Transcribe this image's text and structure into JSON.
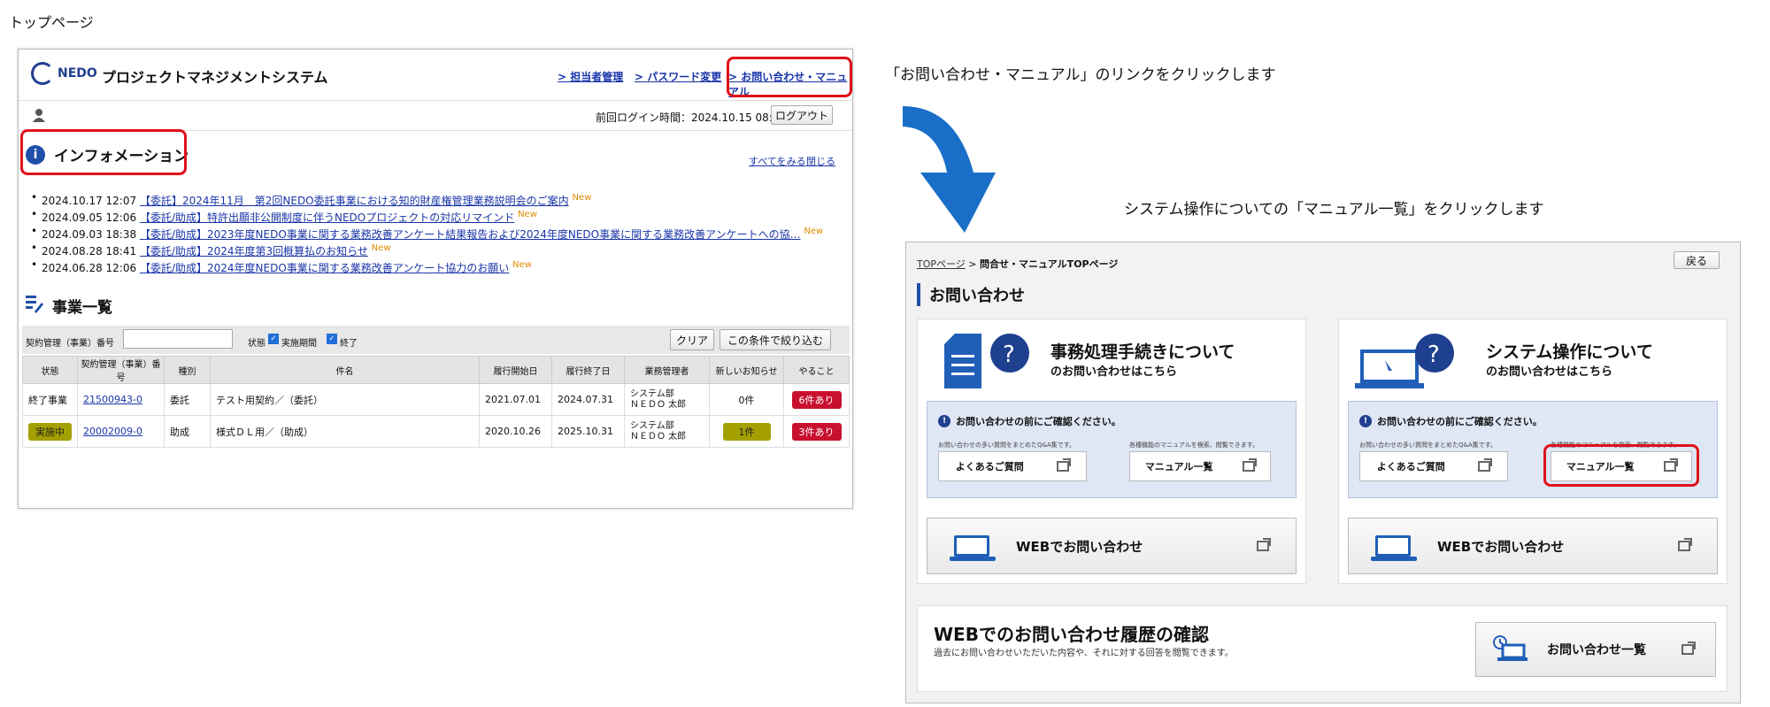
{
  "page_label": "トップページ",
  "caption1": "「お問い合わせ・マニュアル」のリンクをクリックします",
  "caption2": "システム操作についての「マニュアル一覧」をクリックします",
  "left": {
    "logo": "NEDO",
    "title": "プロジェクトマネジメントシステム",
    "links": [
      "> 担当者管理",
      "> パスワード変更",
      "> お問い合わせ・マニュアル"
    ],
    "last_login": "前回ログイン時間：2024.10.15 08:17",
    "logout": "ログアウト",
    "info_title": "インフォメーション",
    "see_all": "すべてをみる",
    "close": "閉じる",
    "new_label": "New",
    "news": [
      {
        "date": "2024.10.17 12:07",
        "text": "【委託】2024年11月　第2回NEDO委託事業における知的財産権管理業務説明会のご案内"
      },
      {
        "date": "2024.09.05 12:06",
        "text": "【委託/助成】特許出願非公開制度に伴うNEDOプロジェクトの対応リマインド"
      },
      {
        "date": "2024.09.03 18:38",
        "text": "【委託/助成】2023年度NEDO事業に関する業務改善アンケート結果報告および2024年度NEDO事業に関する業務改善アンケートへの協…"
      },
      {
        "date": "2024.08.28 18:41",
        "text": "【委託/助成】2024年度第3回概算払のお知らせ"
      },
      {
        "date": "2024.06.28 12:06",
        "text": "【委託/助成】2024年度NEDO事業に関する業務改善アンケート協力のお願い"
      }
    ],
    "biz_title": "事業一覧",
    "filter_label": "契約管理（事業）番号",
    "status_label": "状態",
    "chk1": "実施期間",
    "chk2": "終了",
    "clear": "クリア",
    "filter_btn": "この条件で絞り込む",
    "columns": [
      "状態",
      "契約管理（事業）番号",
      "種別",
      "件名",
      "履行開始日",
      "履行終了日",
      "業務管理者",
      "新しいお知らせ",
      "やること"
    ],
    "rows": [
      {
        "status": "終了事業",
        "no": "21500943-0",
        "kind": "委託",
        "name": "テスト用契約／（委託）",
        "start": "2021.07.01",
        "end": "2024.07.31",
        "mgr1": "システム部",
        "mgr2": "ＮＥＤＯ 太郎",
        "news": "0件",
        "todo": "6件あり"
      },
      {
        "status": "実施中",
        "no": "20002009-0",
        "kind": "助成",
        "name": "様式ＤＬ用／（助成）",
        "start": "2020.10.26",
        "end": "2025.10.31",
        "mgr1": "システム部",
        "mgr2": "ＮＥＤＯ 太郎",
        "news": "1件",
        "todo": "3件あり"
      }
    ]
  },
  "right": {
    "breadcrumb_top": "TOPページ",
    "breadcrumb_sep": ">",
    "breadcrumb_cur": "問合せ・マニュアルTOPページ",
    "back": "戻る",
    "heading": "お問い合わせ",
    "card1_title": "事務処理手続きについて",
    "card2_title": "システム操作について",
    "card_sub": "のお問い合わせはこちら",
    "notice": "お問い合わせの前にご確認ください。",
    "small1": "お問い合わせの多い質問をまとめたQ&A集です。",
    "small2": "各種機能のマニュアルを検索、閲覧できます。",
    "faq": "よくあるご質問",
    "manual": "マニュアル一覧",
    "web": "WEBでお問い合わせ",
    "history_title": "WEBでのお問い合わせ履歴の確認",
    "history_sub": "過去にお問い合わせいただいた内容や、それに対する回答を閲覧できます。",
    "history_btn": "お問い合わせ一覧"
  },
  "colors": {
    "accent": "#1f4fa8",
    "highlight": "#e0101a",
    "badge_red": "#c8102e",
    "badge_olive": "#a4a000",
    "arrow": "#1a6ec8"
  }
}
